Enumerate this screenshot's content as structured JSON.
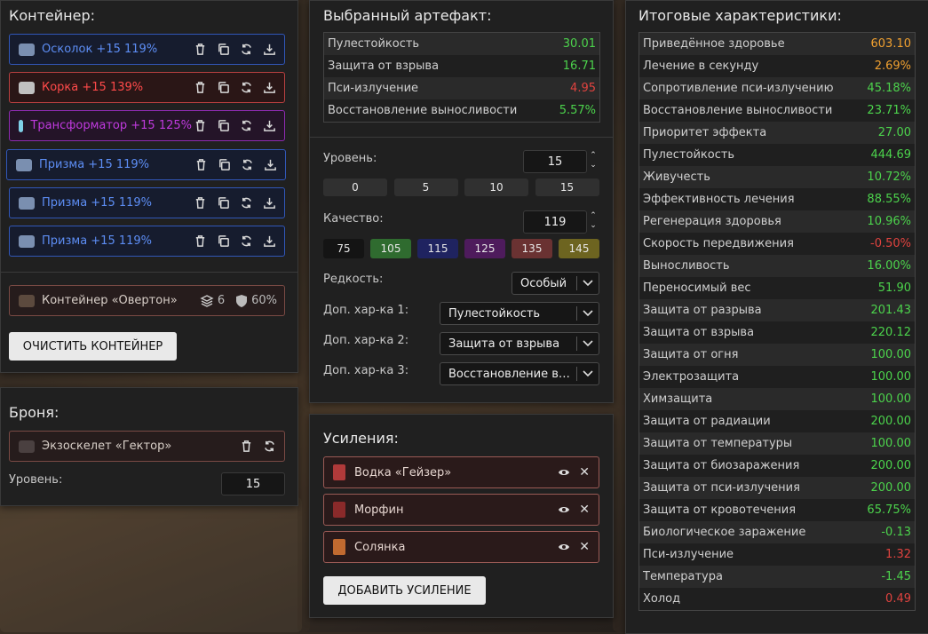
{
  "container": {
    "title": "Контейнер:",
    "artifacts": [
      {
        "name": "Осколок +15 119%",
        "color": "blue"
      },
      {
        "name": "Корка +15 139%",
        "color": "red"
      },
      {
        "name": "Трансформатор +15 125%",
        "color": "purple"
      },
      {
        "name": "Призма +15 119%",
        "color": "blue"
      },
      {
        "name": "Призма +15 119%",
        "color": "blue"
      },
      {
        "name": "Призма +15 119%",
        "color": "blue"
      }
    ],
    "container_item": {
      "name": "Контейнер «Овертон»",
      "slots": "6",
      "protection": "60%"
    },
    "clear_button": "ОЧИСТИТЬ КОНТЕЙНЕР"
  },
  "armor": {
    "title": "Броня:",
    "item": "Экзоскелет «Гектор»",
    "level_label": "Уровень:",
    "level_value": "15"
  },
  "selected": {
    "title": "Выбранный артефакт:",
    "stats": [
      {
        "k": "Пулестойкость",
        "v": "30.01",
        "c": "green"
      },
      {
        "k": "Защита от взрыва",
        "v": "16.71",
        "c": "green"
      },
      {
        "k": "Пси-излучение",
        "v": "4.95",
        "c": "red"
      },
      {
        "k": "Восстановление выносливости",
        "v": "5.57%",
        "c": "green"
      }
    ],
    "level_label": "Уровень:",
    "level_value": "15",
    "level_presets": [
      "0",
      "5",
      "10",
      "15"
    ],
    "quality_label": "Качество:",
    "quality_value": "119",
    "quality_presets": [
      {
        "v": "75",
        "bg": "#141414"
      },
      {
        "v": "105",
        "bg": "#2f6b2f"
      },
      {
        "v": "115",
        "bg": "#1f2360"
      },
      {
        "v": "125",
        "bg": "#4e1b5c"
      },
      {
        "v": "135",
        "bg": "#6a3232"
      },
      {
        "v": "145",
        "bg": "#6d6420"
      }
    ],
    "rarity_label": "Редкость:",
    "rarity_value": "Особый",
    "extra1_label": "Доп. хар-ка 1:",
    "extra1_value": "Пулестойкость",
    "extra2_label": "Доп. хар-ка 2:",
    "extra2_value": "Защита от взрыва",
    "extra3_label": "Доп. хар-ка 3:",
    "extra3_value": "Восстановление выносливости"
  },
  "boosts": {
    "title": "Усиления:",
    "items": [
      {
        "name": "Водка «Гейзер»",
        "icon_color": "#b03a3a"
      },
      {
        "name": "Морфин",
        "icon_color": "#8a2a2a"
      },
      {
        "name": "Солянка",
        "icon_color": "#c06a30"
      }
    ],
    "add_button": "ДОБАВИТЬ УСИЛЕНИЕ"
  },
  "totals": {
    "title": "Итоговые характеристики:",
    "stats": [
      {
        "k": "Приведённое здоровье",
        "v": "603.10",
        "c": "orange"
      },
      {
        "k": "Лечение в секунду",
        "v": "2.69%",
        "c": "orange"
      },
      {
        "k": "Сопротивление пси-излучению",
        "v": "45.18%",
        "c": "green"
      },
      {
        "k": "Восстановление выносливости",
        "v": "23.71%",
        "c": "green"
      },
      {
        "k": "Приоритет эффекта",
        "v": "27.00",
        "c": "green"
      },
      {
        "k": "Пулестойкость",
        "v": "444.69",
        "c": "green"
      },
      {
        "k": "Живучесть",
        "v": "10.72%",
        "c": "green"
      },
      {
        "k": "Эффективность лечения",
        "v": "88.55%",
        "c": "green"
      },
      {
        "k": "Регенерация здоровья",
        "v": "10.96%",
        "c": "green"
      },
      {
        "k": "Скорость передвижения",
        "v": "-0.50%",
        "c": "red"
      },
      {
        "k": "Выносливость",
        "v": "16.00%",
        "c": "green"
      },
      {
        "k": "Переносимый вес",
        "v": "51.90",
        "c": "green"
      },
      {
        "k": "Защита от разрыва",
        "v": "201.43",
        "c": "green"
      },
      {
        "k": "Защита от взрыва",
        "v": "220.12",
        "c": "green"
      },
      {
        "k": "Защита от огня",
        "v": "100.00",
        "c": "green"
      },
      {
        "k": "Электрозащита",
        "v": "100.00",
        "c": "green"
      },
      {
        "k": "Химзащита",
        "v": "100.00",
        "c": "green"
      },
      {
        "k": "Защита от радиации",
        "v": "200.00",
        "c": "green"
      },
      {
        "k": "Защита от температуры",
        "v": "100.00",
        "c": "green"
      },
      {
        "k": "Защита от биозаражения",
        "v": "200.00",
        "c": "green"
      },
      {
        "k": "Защита от пси-излучения",
        "v": "200.00",
        "c": "green"
      },
      {
        "k": "Защита от кровотечения",
        "v": "65.75%",
        "c": "green"
      },
      {
        "k": "Биологическое заражение",
        "v": "-0.13",
        "c": "green"
      },
      {
        "k": "Пси-излучение",
        "v": "1.32",
        "c": "red"
      },
      {
        "k": "Температура",
        "v": "-1.45",
        "c": "green"
      },
      {
        "k": "Холод",
        "v": "0.49",
        "c": "red"
      }
    ]
  },
  "colors": {
    "green": "#4cd34c",
    "red": "#e0433f",
    "orange": "#f0a030"
  }
}
